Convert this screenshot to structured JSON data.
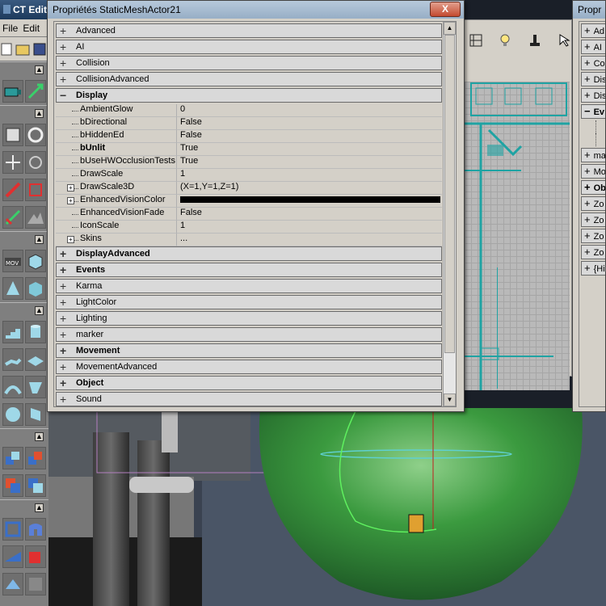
{
  "app": {
    "title": "CT Edito",
    "menu": [
      "File",
      "Edit"
    ]
  },
  "main_window": {
    "title": "Propriétés StaticMeshActor21",
    "close_symbol": "X",
    "categories_before": [
      {
        "label": "Advanced",
        "bold": false
      },
      {
        "label": "AI",
        "bold": false
      },
      {
        "label": "Collision",
        "bold": false
      },
      {
        "label": "CollisionAdvanced",
        "bold": false
      }
    ],
    "expanded_category": {
      "label": "Display",
      "sign": "−"
    },
    "properties": [
      {
        "name": "AmbientGlow",
        "value": "0",
        "bold": false,
        "expandable": false
      },
      {
        "name": "bDirectional",
        "value": "False",
        "bold": false,
        "expandable": false
      },
      {
        "name": "bHiddenEd",
        "value": "False",
        "bold": false,
        "expandable": false
      },
      {
        "name": "bUnlit",
        "value": "True",
        "bold": true,
        "expandable": false
      },
      {
        "name": "bUseHWOcclusionTests",
        "value": "True",
        "bold": false,
        "expandable": false
      },
      {
        "name": "DrawScale",
        "value": "1",
        "bold": false,
        "expandable": false
      },
      {
        "name": "DrawScale3D",
        "value": "(X=1,Y=1,Z=1)",
        "bold": false,
        "expandable": true
      },
      {
        "name": "EnhancedVisionColor",
        "value": "",
        "bold": false,
        "expandable": true,
        "color": "#000000"
      },
      {
        "name": "EnhancedVisionFade",
        "value": "False",
        "bold": false,
        "expandable": false
      },
      {
        "name": "IconScale",
        "value": "1",
        "bold": false,
        "expandable": false
      },
      {
        "name": "Skins",
        "value": "...",
        "bold": false,
        "expandable": true
      }
    ],
    "categories_after": [
      {
        "label": "DisplayAdvanced",
        "bold": true
      },
      {
        "label": "Events",
        "bold": true
      },
      {
        "label": "Karma",
        "bold": false
      },
      {
        "label": "LightColor",
        "bold": false
      },
      {
        "label": "Lighting",
        "bold": false
      },
      {
        "label": "marker",
        "bold": false
      },
      {
        "label": "Movement",
        "bold": true
      },
      {
        "label": "MovementAdvanced",
        "bold": false
      },
      {
        "label": "Object",
        "bold": true
      },
      {
        "label": "Sound",
        "bold": false
      }
    ],
    "plus_sign": "+"
  },
  "side_window": {
    "title": "Propr",
    "categories_top": [
      {
        "label": "Ad",
        "bold": false
      },
      {
        "label": "AI",
        "bold": false
      },
      {
        "label": "Co",
        "bold": false
      },
      {
        "label": "Dis",
        "bold": false
      },
      {
        "label": "Dis",
        "bold": false
      }
    ],
    "expanded": {
      "label": "Ev",
      "bold": true
    },
    "categories_bottom": [
      {
        "label": "ma",
        "bold": false
      },
      {
        "label": "Mo",
        "bold": false
      },
      {
        "label": "Ob",
        "bold": true
      },
      {
        "label": "Zo",
        "bold": false
      },
      {
        "label": "Zo",
        "bold": false
      },
      {
        "label": "Zo",
        "bold": false
      },
      {
        "label": "Zo",
        "bold": false
      },
      {
        "label": "{Hi",
        "bold": false
      }
    ]
  },
  "toolbox_icons": [
    [
      "camera-icon",
      "move-icon"
    ],
    [
      "brush-clip-icon",
      "rotate-icon"
    ],
    [
      "scale-icon",
      "vertex-icon"
    ],
    [
      "polygon-icon",
      "texture-pan-icon"
    ],
    [
      "mirror-icon",
      "terrain-icon"
    ],
    [
      "matinee-icon",
      "cube-icon"
    ],
    [
      "cone-icon",
      "box-icon"
    ],
    [
      "stairs-icon",
      "cylinder-icon"
    ],
    [
      "spiral-stairs-icon",
      "sheet-icon"
    ],
    [
      "curved-stairs-icon",
      "volumetric-icon"
    ],
    [
      "sphere-icon",
      "tetrahedron-icon"
    ],
    [
      "add-brush-icon",
      "subtract-brush-icon"
    ],
    [
      "intersect-icon",
      "deintersect-icon"
    ],
    [
      "select-icon",
      "mover-icon"
    ],
    [
      "add-special-icon",
      "add-antiportal-icon"
    ],
    [
      "volume-icon",
      "hide-icon"
    ]
  ],
  "colors": {
    "accent_teal": "#1fa3a3",
    "viewport_green": "#2d8a3a",
    "close_red": "#c34a30"
  }
}
